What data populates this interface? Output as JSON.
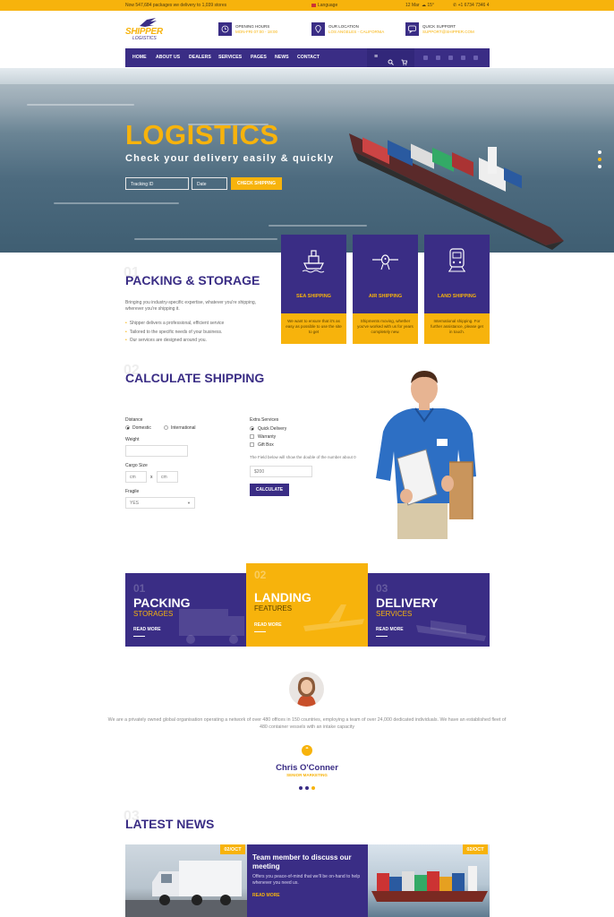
{
  "topbar": {
    "notice": "Now 547,684 packages we delivery to 1,039 stores",
    "language": "Language",
    "date": "12 Mar",
    "temp": "15°",
    "phone": "+1 6734 7346 4"
  },
  "header": {
    "logo_main": "SHIPPER",
    "logo_sub": "LOGISTICS",
    "info": [
      {
        "label": "OPENING HOURS",
        "value": "MON-FRI 07:00 - 18:00",
        "icon": "clock-icon"
      },
      {
        "label": "OUR LOCATION",
        "value": "LOS ANGELES - CALIFORNIA",
        "icon": "location-pin-icon"
      },
      {
        "label": "QUICK SUPPORT",
        "value": "SUPPORT@SHIPPER.COM",
        "icon": "chat-bubble-icon"
      }
    ]
  },
  "nav": {
    "items": [
      "HOME",
      "ABOUT US",
      "DEALERS",
      "SERVICES",
      "PAGES",
      "NEWS",
      "CONTACT"
    ]
  },
  "hero": {
    "title": "LOGISTICS",
    "subtitle": "Check your delivery easily & quickly",
    "tracking_placeholder": "Tracking ID",
    "date_placeholder": "Date",
    "button": "CHECK SHIPPING"
  },
  "packing": {
    "number": "01",
    "title": "PACKING & STORAGE",
    "description": "Bringing you industry-specific expertise, whatever you're shipping, wherever you're shipping it.",
    "bullets": [
      "Shipper delivers a professional, efficient service",
      "Tailored to the specific needs of your business.",
      "Our services are designed around you."
    ]
  },
  "cards": [
    {
      "title": "SEA SHIPPING",
      "text": "We want to ensure that it's as easy as possible to use the site to get",
      "icon": "ship-icon"
    },
    {
      "title": "AIR SHIPPING",
      "text": "Shipments moving, whether you've worked with us for years completely new.",
      "icon": "plane-icon"
    },
    {
      "title": "LAND SHIPPING",
      "text": "International shipping. For further assistance, please get in touch.",
      "icon": "train-icon"
    }
  ],
  "calculate": {
    "number": "02",
    "title": "CALCULATE SHIPPING",
    "distance_label": "Distance",
    "domestic": "Domestic",
    "international": "International",
    "weight_label": "Weight",
    "cargo_label": "Cargo Size",
    "cm": "cm",
    "x": "x",
    "fragile_label": "Fragile",
    "fragile_value": "YES",
    "extra_label": "Extra Services",
    "extra": [
      "Quick Delivery",
      "Warranty",
      "Gift Box"
    ],
    "note": "The Field below will show the double of the number about 0",
    "result": "$200",
    "button": "CALCULATE"
  },
  "features": [
    {
      "number": "01",
      "title": "PACKING",
      "subtitle": "STORAGES",
      "link": "READ MORE"
    },
    {
      "number": "02",
      "title": "LANDING",
      "subtitle": "FEATURES",
      "link": "READ MORE"
    },
    {
      "number": "03",
      "title": "DELIVERY",
      "subtitle": "SERVICES",
      "link": "READ MORE"
    }
  ],
  "testimonial": {
    "quote": "We are a privately owned global organisation operating a network of over 480 offices in 150 countries, employing a team of over 24,000 dedicated individuals. We have an established fleet of 480 container vessels with an intake capacity",
    "name": "Chris O'Conner",
    "role": "SENIOR MARKETING"
  },
  "news": {
    "number": "03",
    "title": "LATEST NEWS",
    "date_left": "02/OCT",
    "date_right": "02/OCT",
    "headline": "Team member to discuss our meeting",
    "text": "Offers you peace-of-mind that we'll be on-hand to help whenever you need us.",
    "link": "READ MORE"
  },
  "colors": {
    "brand_purple": "#3a2d85",
    "brand_yellow": "#f7b30c"
  }
}
